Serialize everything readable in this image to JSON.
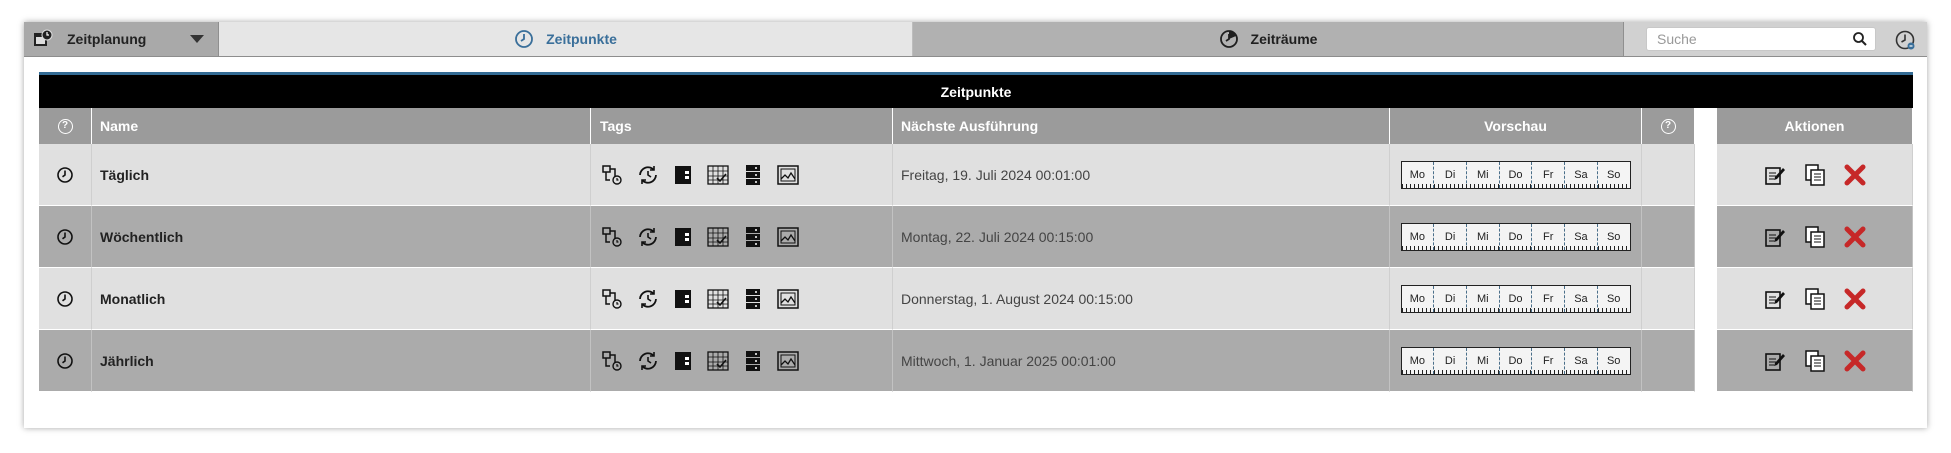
{
  "topbar": {
    "planner_label": "Zeitplanung",
    "tabs": [
      {
        "label": "Zeitpunkte",
        "active": true
      },
      {
        "label": "Zeiträume",
        "active": false
      }
    ],
    "search_placeholder": "Suche"
  },
  "table": {
    "title": "Zeitpunkte",
    "headers": {
      "help": "?",
      "name": "Name",
      "tags": "Tags",
      "next_run": "Nächste Ausführung",
      "preview": "Vorschau",
      "help2": "?",
      "actions": "Aktionen"
    },
    "weekdays": [
      "Mo",
      "Di",
      "Mi",
      "Do",
      "Fr",
      "Sa",
      "So"
    ],
    "rows": [
      {
        "name": "Täglich",
        "next_run": "Freitag, 19. Juli 2024 00:01:00"
      },
      {
        "name": "Wöchentlich",
        "next_run": "Montag, 22. Juli 2024 00:15:00"
      },
      {
        "name": "Monatlich",
        "next_run": "Donnerstag, 1. August 2024 00:15:00"
      },
      {
        "name": "Jährlich",
        "next_run": "Mittwoch, 1. Januar 2025 00:01:00"
      }
    ]
  },
  "colors": {
    "accent": "#3a6f9a",
    "delete": "#c62828",
    "header_bg": "#9b9b9b",
    "title_bg": "#000000"
  },
  "icons": {
    "tags": [
      "flow-icon",
      "cycle-icon",
      "document-icon",
      "calendar-icon",
      "database-icon",
      "image-icon"
    ],
    "actions": [
      "edit-icon",
      "copy-icon",
      "delete-icon"
    ]
  }
}
